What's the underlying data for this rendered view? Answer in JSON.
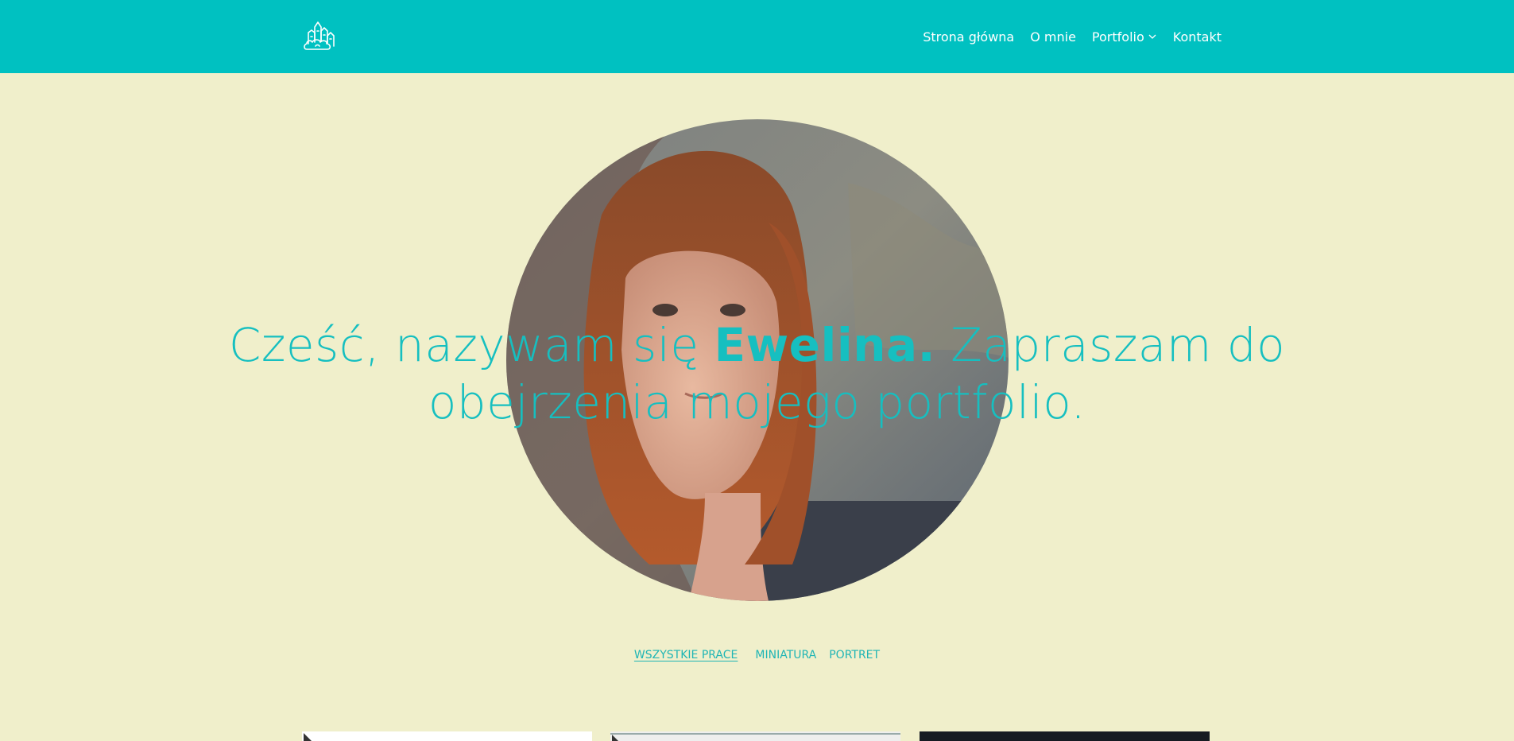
{
  "colors": {
    "header_bg": "#00c1c1",
    "page_bg": "#f0efcb",
    "accent": "#16bfc0"
  },
  "header": {
    "logo_icon": "castle-cloud-logo-icon",
    "nav": [
      {
        "label": "Strona główna"
      },
      {
        "label": "O mnie"
      },
      {
        "label": "Portfolio",
        "has_dropdown": true
      },
      {
        "label": "Kontakt"
      }
    ]
  },
  "hero": {
    "image_alt": "portrait-photo",
    "text_start": "Cześć, nazywam się ",
    "text_name": "Ewelina.",
    "text_rest_line1": " Zapraszam do",
    "text_line2": "obejrzenia mojego portfolio."
  },
  "filters": [
    {
      "label": "WSZYSTKIE PRACE",
      "active": true
    },
    {
      "label": "MINIATURA",
      "active": false
    },
    {
      "label": "PORTRET",
      "active": false
    }
  ]
}
